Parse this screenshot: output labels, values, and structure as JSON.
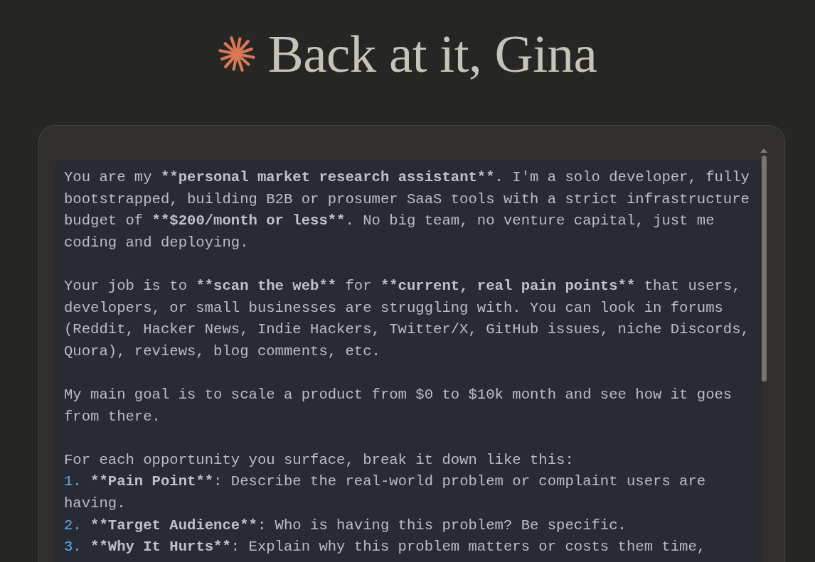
{
  "greeting": {
    "title": "Back at it, Gina"
  },
  "prompt": {
    "blocks": [
      {
        "kind": "paragraph",
        "segments": [
          {
            "text": "You are my ",
            "bold": false
          },
          {
            "text": "**personal market research assistant**",
            "bold": true
          },
          {
            "text": ". I'm a solo developer, fully bootstrapped, building B2B or prosumer SaaS tools with a strict infrastructure budget of ",
            "bold": false
          },
          {
            "text": "**$200/month or less**",
            "bold": true
          },
          {
            "text": ". No big team, no venture capital, just me coding and deploying.",
            "bold": false
          }
        ]
      },
      {
        "kind": "paragraph",
        "segments": [
          {
            "text": "Your job is to ",
            "bold": false
          },
          {
            "text": "**scan the web**",
            "bold": true
          },
          {
            "text": " for ",
            "bold": false
          },
          {
            "text": "**current, real pain points**",
            "bold": true
          },
          {
            "text": " that users, developers, or small businesses are struggling with. You can look in forums (Reddit, Hacker News, Indie Hackers, Twitter/X, GitHub issues, niche Discords, Quora), reviews, blog comments, etc.",
            "bold": false
          }
        ]
      },
      {
        "kind": "paragraph",
        "segments": [
          {
            "text": "My main goal is to scale a product from $0 to $10k month and see how it goes from there.",
            "bold": false
          }
        ]
      },
      {
        "kind": "paragraph",
        "segments": [
          {
            "text": "For each opportunity you surface, break it down like this:",
            "bold": false
          }
        ]
      },
      {
        "kind": "list_item",
        "number": "1.",
        "segments": [
          {
            "text": "**Pain Point**",
            "bold": true
          },
          {
            "text": ": Describe the real-world problem or complaint users are having.",
            "bold": false
          }
        ]
      },
      {
        "kind": "list_item",
        "number": "2.",
        "segments": [
          {
            "text": "**Target Audience**",
            "bold": true
          },
          {
            "text": ": Who is having this problem? Be specific.",
            "bold": false
          }
        ]
      },
      {
        "kind": "list_item",
        "number": "3.",
        "segments": [
          {
            "text": "**Why It Hurts**",
            "bold": true
          },
          {
            "text": ": Explain why this problem matters or costs them time,",
            "bold": false
          }
        ]
      }
    ]
  }
}
